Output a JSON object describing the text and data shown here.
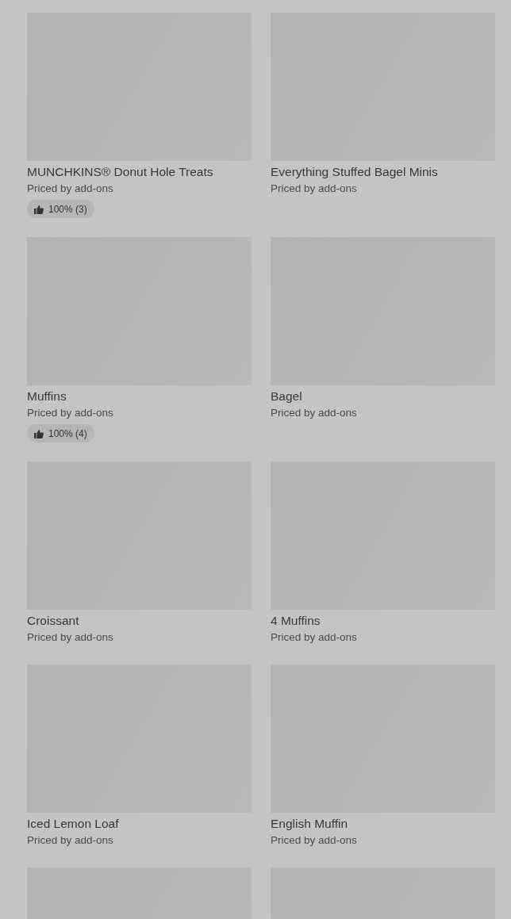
{
  "items": [
    {
      "kind": "product",
      "title": "MUNCHKINS® Donut Hole Treats",
      "subtitle": "Priced by add-ons",
      "rating": "100% (3)"
    },
    {
      "kind": "product",
      "title": "Everything Stuffed Bagel Minis",
      "subtitle": "Priced by add-ons"
    },
    {
      "kind": "product",
      "title": "Muffins",
      "subtitle": "Priced by add-ons",
      "rating": "100% (4)"
    },
    {
      "kind": "product",
      "title": "Bagel",
      "subtitle": "Priced by add-ons"
    },
    {
      "kind": "product",
      "title": "Croissant",
      "subtitle": "Priced by add-ons"
    },
    {
      "kind": "product",
      "title": "4 Muffins",
      "subtitle": "Priced by add-ons"
    },
    {
      "kind": "product",
      "title": "Iced Lemon Loaf",
      "subtitle": "Priced by add-ons"
    },
    {
      "kind": "product",
      "title": "English Muffin",
      "subtitle": "Priced by add-ons"
    },
    {
      "kind": "product"
    },
    {
      "kind": "product"
    }
  ]
}
